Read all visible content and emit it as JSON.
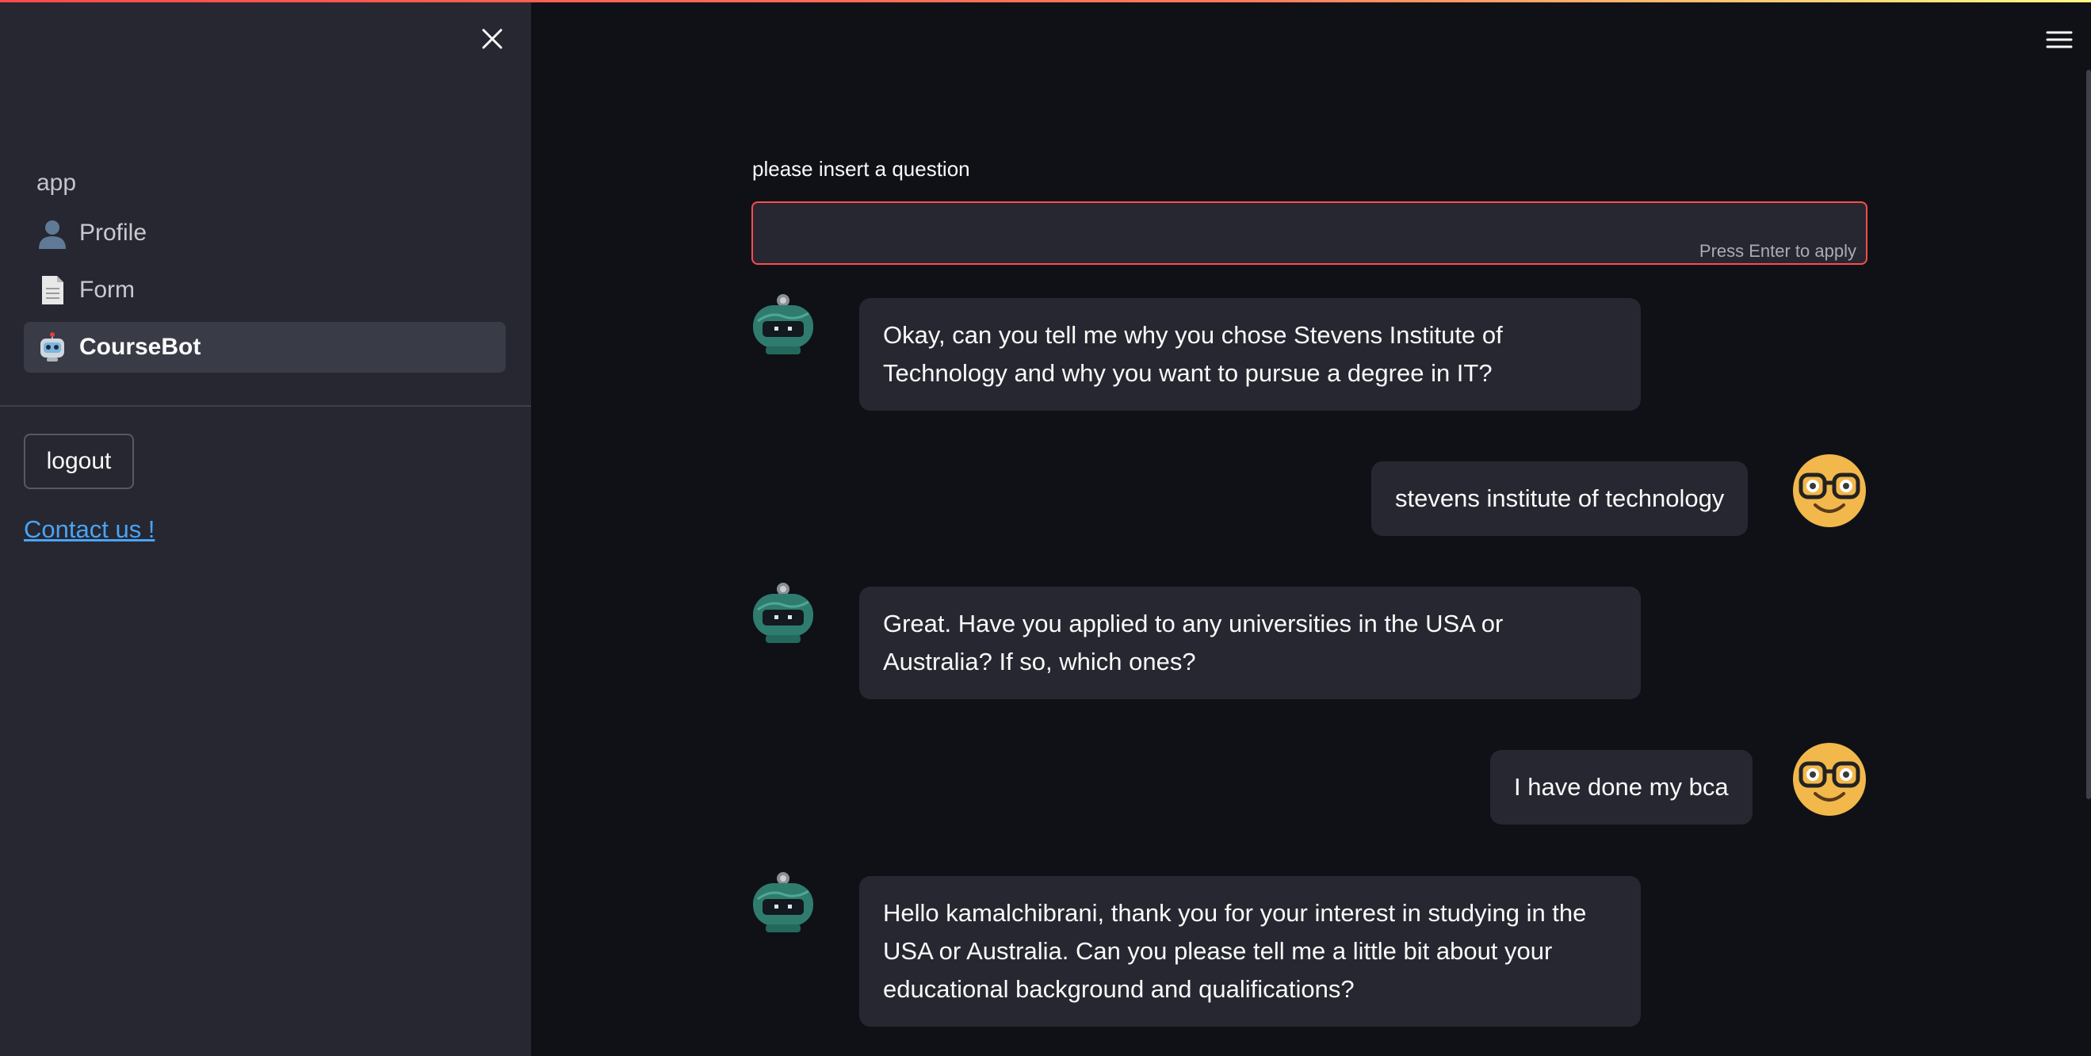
{
  "sidebar": {
    "nav_title": "app",
    "items": [
      {
        "label": "Profile",
        "icon": "bust-in-silhouette-icon",
        "active": false
      },
      {
        "label": "Form",
        "icon": "page-facing-up-icon",
        "active": false
      },
      {
        "label": "CourseBot",
        "icon": "robot-icon",
        "active": true
      }
    ],
    "logout_label": "logout",
    "contact_label": "Contact us !"
  },
  "main": {
    "question_label": "please insert a question",
    "input_value": "",
    "input_hint": "Press Enter to apply",
    "messages": [
      {
        "role": "bot",
        "text": "Okay, can you tell me why you chose Stevens Institute of Technology and why you want to pursue a degree in IT?"
      },
      {
        "role": "user",
        "text": "stevens institute of technology"
      },
      {
        "role": "bot",
        "text": "Great. Have you applied to any universities in the USA or Australia? If so, which ones?"
      },
      {
        "role": "user",
        "text": "I have done my bca"
      },
      {
        "role": "bot",
        "text": "Hello kamalchibrani, thank you for your interest in studying in the USA or Australia. Can you please tell me a little bit about your educational background and qualifications?"
      }
    ]
  },
  "colors": {
    "accent": "#ff4b4b",
    "background": "#0f1117",
    "sidebar": "#262730",
    "link": "#4aa3f5"
  }
}
